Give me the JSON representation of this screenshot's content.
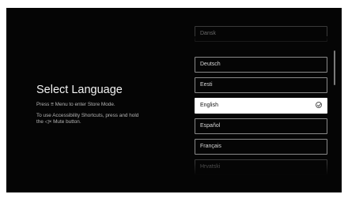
{
  "screen": {
    "title": "Select Language",
    "store_mode_hint": {
      "prefix": "Press ",
      "icon": "menu-icon",
      "glyph": "≡",
      "suffix": " Menu to enter Store Mode."
    },
    "accessibility_hint": {
      "line1": "To use Accessibility Shortcuts, press and hold",
      "prefix2": "the ",
      "icon": "mute-icon",
      "glyph": "◁×",
      "suffix2": " Mute button."
    }
  },
  "languages": [
    {
      "label": "Dansk"
    },
    {
      "label": "Deutsch"
    },
    {
      "label": "Eesti"
    },
    {
      "label": "English",
      "selected": true
    },
    {
      "label": "Español"
    },
    {
      "label": "Français"
    },
    {
      "label": "Hrvatski"
    }
  ]
}
